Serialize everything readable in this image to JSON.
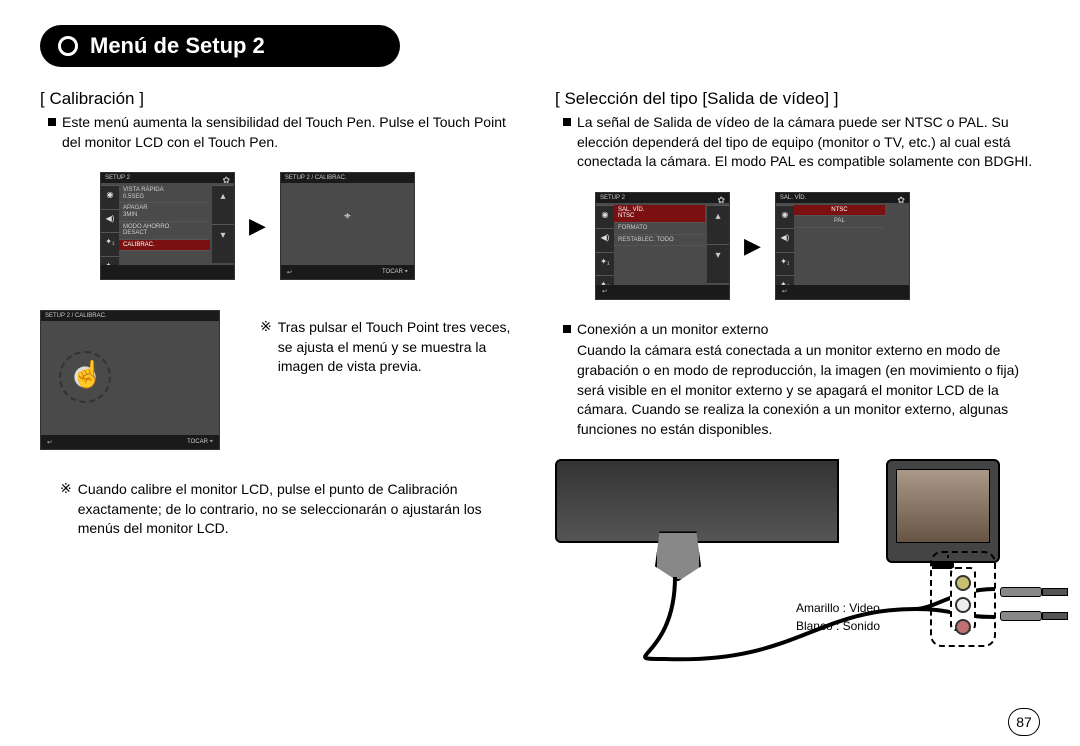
{
  "page_title": "Menú de Setup 2",
  "page_number": "87",
  "left": {
    "section_title": "[ Calibración ]",
    "intro": "Este menú aumenta la sensibilidad del Touch Pen. Pulse el Touch Point del monitor LCD con el Touch Pen.",
    "screen1": {
      "header": "SETUP 2",
      "items": [
        {
          "line1": "VISTA RÁPIDA",
          "line2": "0.5SEG"
        },
        {
          "line1": "APAGAR",
          "line2": "3MIN"
        },
        {
          "line1": "MODO AHORRO.",
          "line2": "DESACT"
        },
        {
          "line1": "CALIBRAC.",
          "line2": ""
        }
      ]
    },
    "screen2": {
      "header": "SETUP 2 / CALIBRAC.",
      "bottom_right": "TOCAR  ⌖"
    },
    "screen3": {
      "header": "SETUP 2 / CALIBRAC.",
      "bottom_right": "TOCAR  ⌖"
    },
    "note1": "Tras pulsar el Touch Point tres veces, se ajusta el menú y se muestra la imagen de vista previa.",
    "note2": "Cuando calibre el monitor LCD, pulse el punto de Calibración exactamente; de lo contrario, no se seleccionarán o ajustarán los menús del monitor LCD."
  },
  "right": {
    "section_title": "[ Selección del tipo [Salida de vídeo] ]",
    "intro": "La señal de Salida de vídeo de la cámara puede ser NTSC o PAL. Su elección dependerá del tipo de equipo (monitor o TV, etc.) al cual está conectada la cámara. El modo PAL es compatible solamente con BDGHI.",
    "screen1": {
      "header": "SETUP 2",
      "items": [
        {
          "line1": "SAL. VÍD.",
          "line2": "NTSC",
          "sel": true
        },
        {
          "line1": "FORMATO",
          "line2": ""
        },
        {
          "line1": "RESTABLEC. TODO",
          "line2": ""
        }
      ]
    },
    "screen2": {
      "header": "SAL. VÍD.",
      "items": [
        {
          "line1": "NTSC",
          "sel": true
        },
        {
          "line1": "PAL"
        }
      ]
    },
    "sub_title": "Conexión a un monitor externo",
    "sub_text": "Cuando la cámara está conectada a un monitor externo en modo de grabación o en modo de reproducción, la imagen (en movimiento o fija) será visible en el monitor externo y se apagará el monitor LCD de la cámara. Cuando se realiza la conexión a un monitor externo, algunas funciones no están disponibles.",
    "conn_label_1": "Amarillo : Video",
    "conn_label_2": "Blanco : Sonido"
  },
  "icons": {
    "back": "↩",
    "up": "▴",
    "down": "▾",
    "camera": "📷",
    "speaker": "🔊",
    "wrench1": "🔧₁",
    "wrench2": "🔧₂",
    "emblem": "✿"
  }
}
